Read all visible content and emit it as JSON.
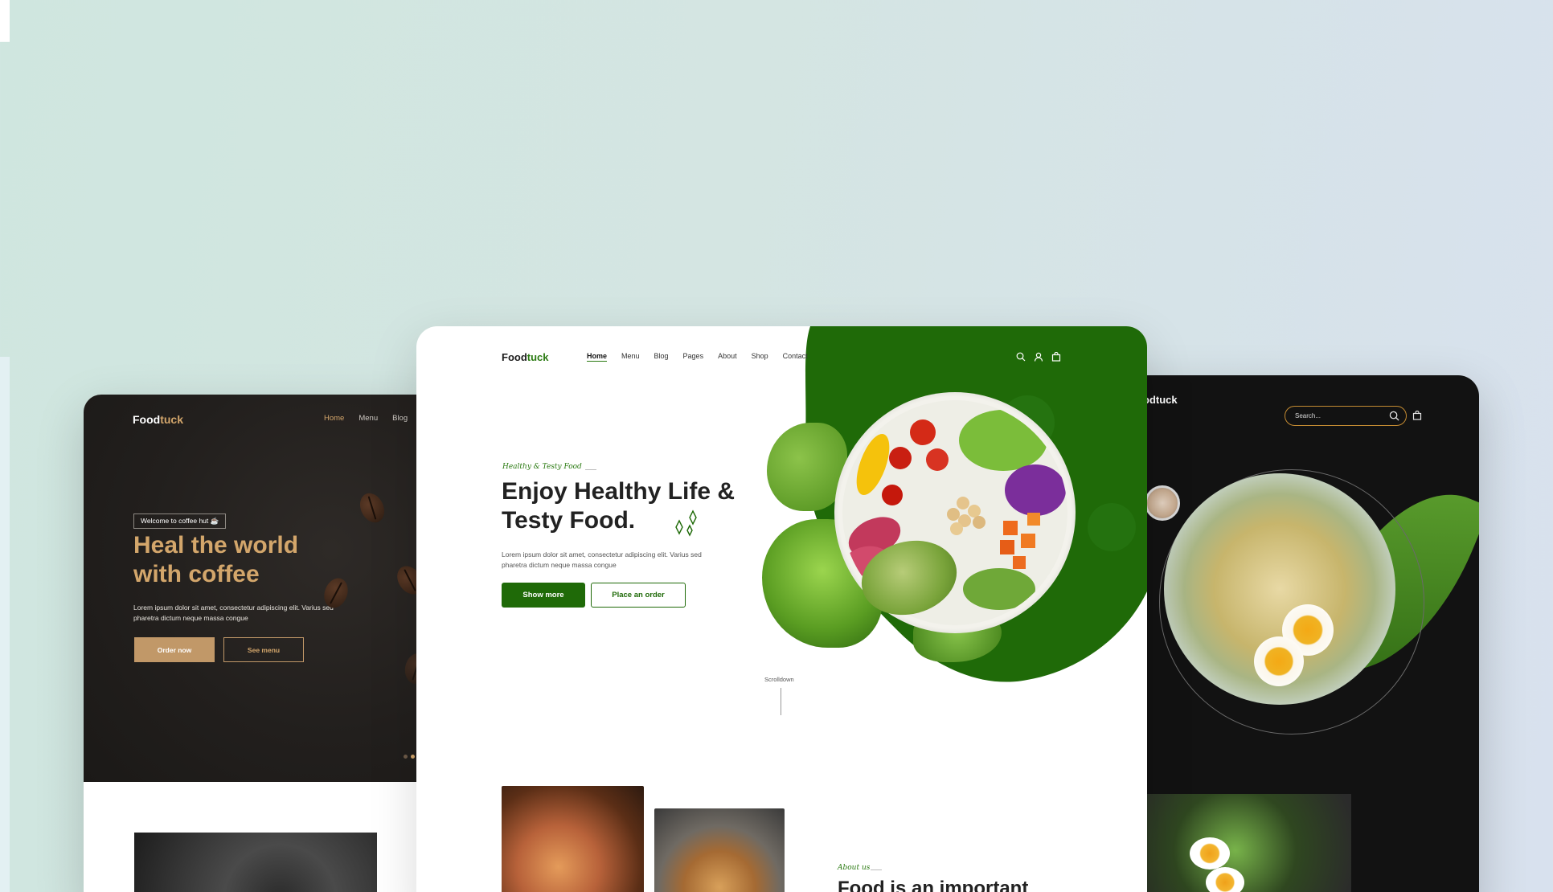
{
  "left_card": {
    "logo_main": "Food",
    "logo_accent": "tuck",
    "nav": [
      "Home",
      "Menu",
      "Blog"
    ],
    "badge": "Welcome to coffee hut ☕",
    "title": "Heal the world with coffee",
    "description": "Lorem ipsum dolor sit amet, consectetur adipiscing elit. Varius sed pharetra dictum neque massa congue",
    "order_button": "Order now",
    "menu_button": "See menu",
    "accent_color": "#d3a66b"
  },
  "center_card": {
    "logo_main": "Food",
    "logo_accent": "tuck",
    "nav": [
      "Home",
      "Menu",
      "Blog",
      "Pages",
      "About",
      "Shop",
      "Contact"
    ],
    "tagline": "Healthy & Testy Food",
    "title": "Enjoy Healthy Life & Testy Food.",
    "description": "Lorem ipsum dolor sit amet, consectetur adipiscing elit. Varius sed pharetra dictum neque massa congue",
    "show_more_button": "Show more",
    "order_button": "Place an order",
    "scroll_label": "Scrolldown",
    "about_tag": "About us",
    "about_title": "Food is an important",
    "accent_color": "#1f6a08",
    "icons": [
      "search-icon",
      "user-icon",
      "bag-icon"
    ]
  },
  "right_card": {
    "logo_visible": "odtuck",
    "search_placeholder": "Search...",
    "accent_color": "#c48b32"
  }
}
